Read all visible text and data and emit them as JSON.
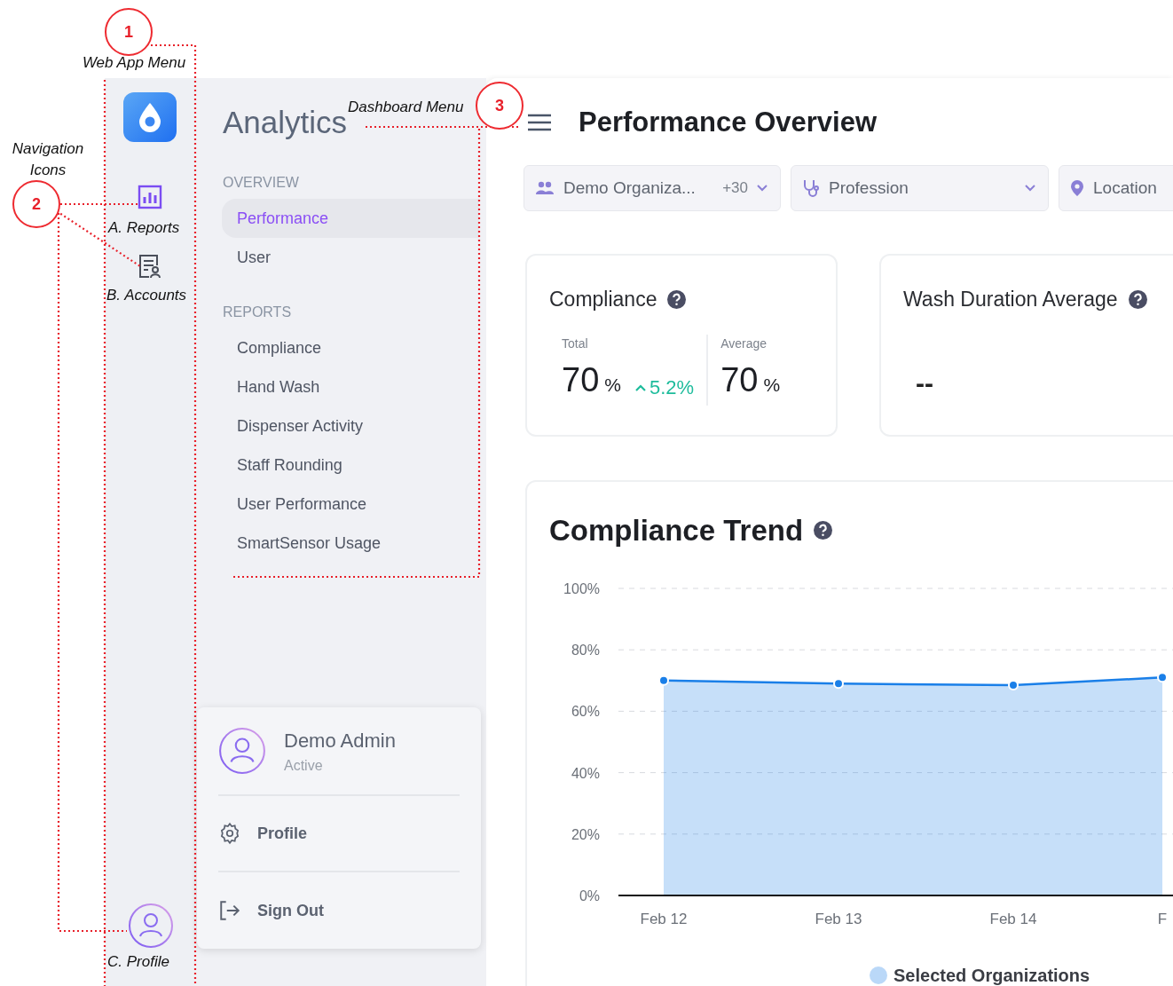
{
  "callouts": [
    {
      "number": "1",
      "label": "Web App Menu"
    },
    {
      "number": "2",
      "label": "Navigation Icons"
    },
    {
      "number": "3",
      "label": "Dashboard Menu"
    }
  ],
  "item_labels": [
    "A. Reports",
    "B. Accounts",
    "C. Profile"
  ],
  "nav_icons": [
    {
      "kind": "reports",
      "selected": true
    },
    {
      "kind": "accounts",
      "selected": false
    }
  ],
  "menu": {
    "title": "Analytics",
    "sections": [
      {
        "heading": "OVERVIEW",
        "items": [
          {
            "label": "Performance",
            "selected": true
          },
          {
            "label": "User",
            "selected": false
          }
        ]
      },
      {
        "heading": "REPORTS",
        "items": [
          {
            "label": "Compliance",
            "selected": false
          },
          {
            "label": "Hand Wash",
            "selected": false
          },
          {
            "label": "Dispenser Activity",
            "selected": false
          },
          {
            "label": "Staff Rounding",
            "selected": false
          },
          {
            "label": "User Performance",
            "selected": false
          },
          {
            "label": "SmartSensor Usage",
            "selected": false
          }
        ]
      }
    ]
  },
  "profile_menu": {
    "name": "Demo Admin",
    "status": "Active",
    "items": [
      {
        "kind": "settings",
        "label": "Profile"
      },
      {
        "kind": "sign_out",
        "label": "Sign Out"
      }
    ]
  },
  "page_title": "Performance Overview",
  "filters": [
    {
      "kind": "organization",
      "label": "Demo Organiza...",
      "extra": "+30"
    },
    {
      "kind": "profession",
      "label": "Profession"
    },
    {
      "kind": "location",
      "label": "Location"
    }
  ],
  "compliance_card": {
    "title": "Compliance",
    "metrics": [
      {
        "label": "Total",
        "value": "70",
        "unit": "%",
        "change": "5.2%"
      },
      {
        "label": "Average",
        "value": "70",
        "unit": "%"
      }
    ]
  },
  "wash_card": {
    "title": "Wash Duration Average",
    "value": "--"
  },
  "trend_card": {
    "title": "Compliance Trend",
    "chart_data": {
      "type": "area",
      "categories": [
        "Feb 12",
        "Feb 13",
        "Feb 14",
        "F"
      ],
      "series": [
        {
          "name": "Selected Organizations",
          "color": "#1a7fe8",
          "values": [
            70,
            69,
            68.5,
            71
          ]
        }
      ],
      "grid": true,
      "ylim": [
        0,
        100
      ],
      "yticks": [
        {
          "value": 0,
          "label": "0%"
        },
        {
          "value": 20,
          "label": "20%"
        },
        {
          "value": 40,
          "label": "40%"
        },
        {
          "value": 60,
          "label": "60%"
        },
        {
          "value": 80,
          "label": "80%"
        },
        {
          "value": 100,
          "label": "100%"
        }
      ]
    }
  }
}
